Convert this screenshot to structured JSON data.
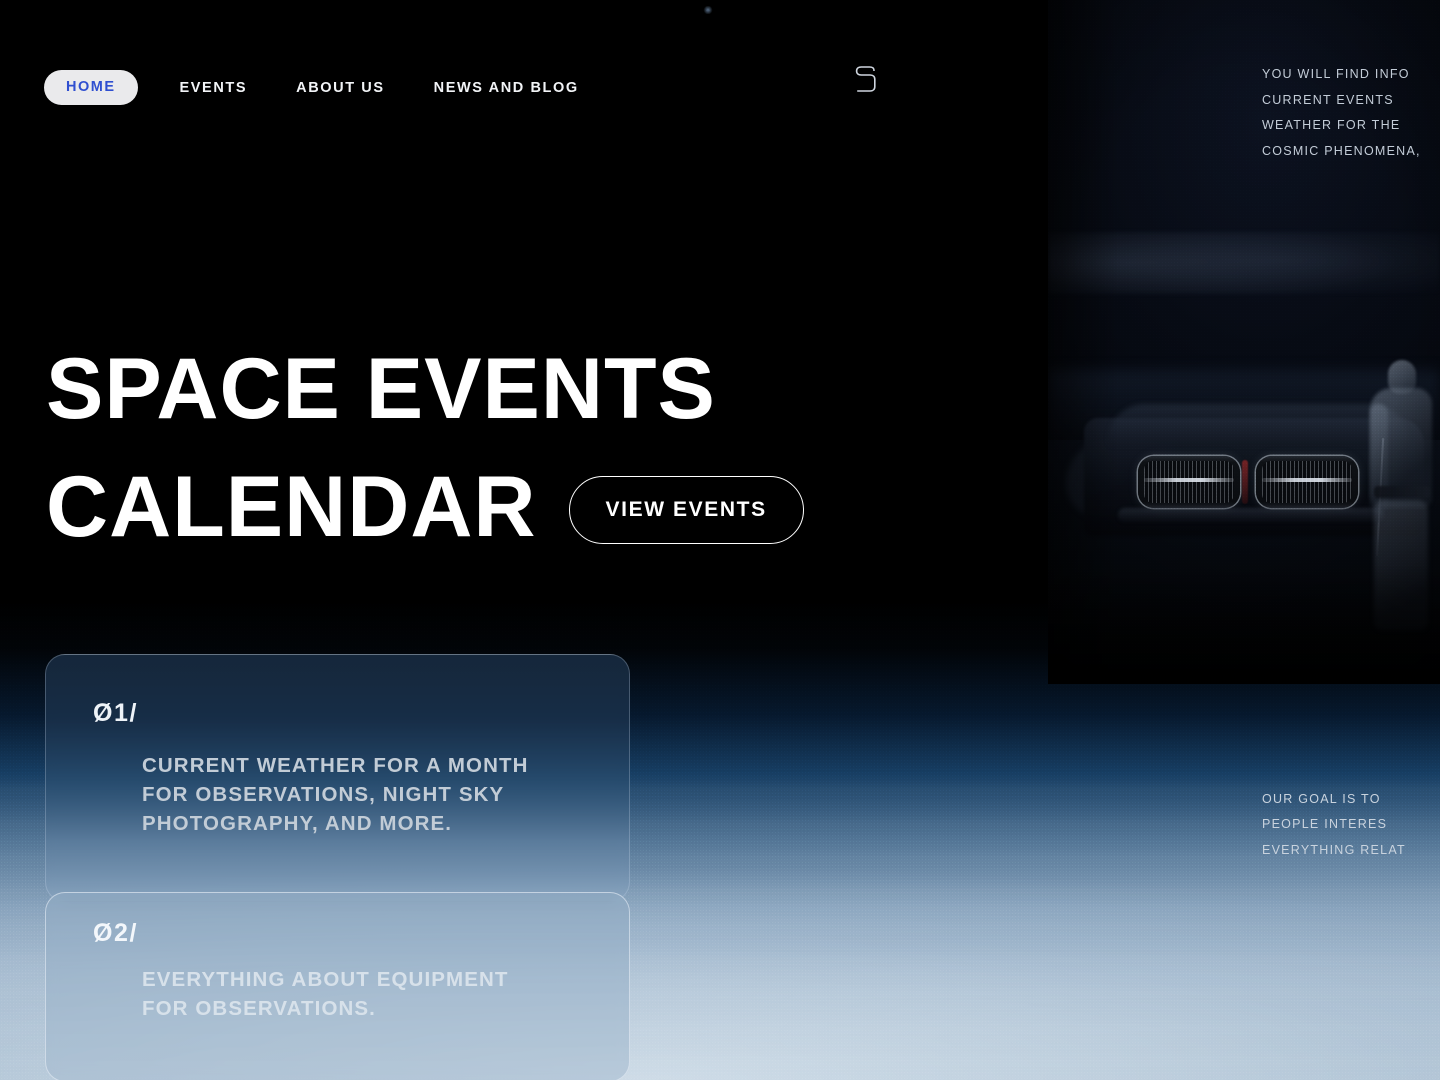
{
  "nav": {
    "items": [
      {
        "label": "HOME",
        "active": true
      },
      {
        "label": "EVENTS",
        "active": false
      },
      {
        "label": "ABOUT US",
        "active": false
      },
      {
        "label": "NEWS AND BLOG",
        "active": false
      }
    ],
    "logo_text": "S",
    "logo_icon": "s-monogram-icon"
  },
  "side_copy": {
    "top": "YOU WILL FIND INFO\nCURRENT EVENTS\nWEATHER FOR THE\nCOSMIC PHENOMENA,",
    "bottom": "OUR GOAL IS TO\nPEOPLE INTERES\nEVERYTHING RELAT"
  },
  "hero": {
    "line1": "SPACE EVENTS",
    "line2": "CALENDAR",
    "cta_label": "VIEW EVENTS"
  },
  "cards": [
    {
      "number": "Ø1/",
      "text": "CURRENT WEATHER FOR A MONTH\nFOR OBSERVATIONS, NIGHT SKY\nPHOTOGRAPHY, AND MORE."
    },
    {
      "number": "Ø2/",
      "text": "EVERYTHING ABOUT EQUIPMENT\nFOR OBSERVATIONS."
    }
  ],
  "colors": {
    "accent_blue": "#2f4fd0",
    "pill_bg": "#eaeaec",
    "text_white": "#ffffff",
    "muted_text": "#c3ccd7",
    "page_bg": "#000000",
    "card_one_top": "#172a3f",
    "card_two_bg": "#92acc4"
  },
  "media": {
    "photo_alt": "night-car-scene-photo",
    "backdrop_alt": "earth-atmosphere-from-orbit"
  }
}
